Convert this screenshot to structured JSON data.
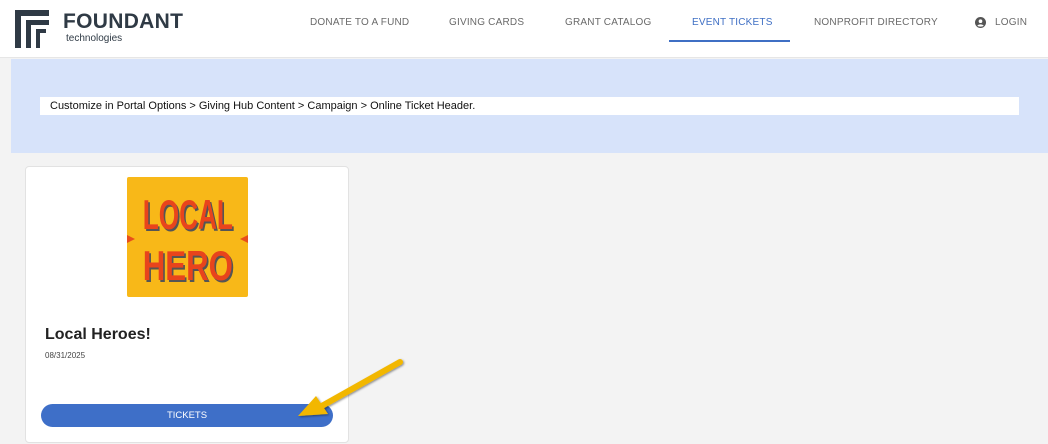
{
  "brand": {
    "name": "FOUNDANT",
    "sub": "technologies",
    "color": "#2f3a45"
  },
  "nav": {
    "items": [
      {
        "label": "DONATE TO A FUND"
      },
      {
        "label": "GIVING CARDS"
      },
      {
        "label": "GRANT CATALOG"
      },
      {
        "label": "EVENT TICKETS",
        "active": true
      },
      {
        "label": "NONPROFIT DIRECTORY"
      }
    ],
    "login_label": "LOGIN",
    "accent": "#3f6fc4"
  },
  "banner": {
    "text": "Customize in Portal Options > Giving Hub Content > Campaign > Online Ticket Header.",
    "color": "#d7e3fa"
  },
  "event": {
    "image_text_line1": "LOCAL",
    "image_text_line2": "HERO",
    "title": "Local Heroes!",
    "date": "08/31/2025",
    "button_label": "TICKETS",
    "button_color": "#3e6fc8"
  },
  "annotation": {
    "arrow_color": "#f2b705",
    "icon": "pointer-arrow"
  }
}
